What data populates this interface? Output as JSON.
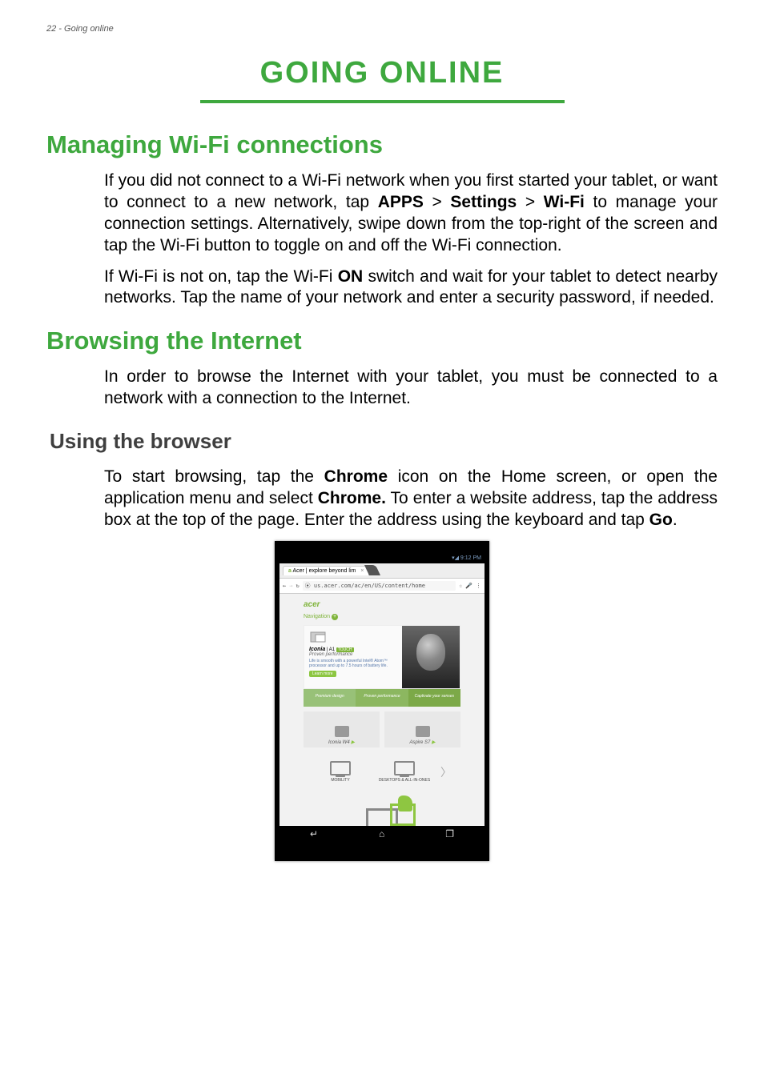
{
  "header": {
    "pageNumber": "22",
    "sectionName": "Going online"
  },
  "title": "GOING ONLINE",
  "sections": {
    "wifi": {
      "heading": "Managing Wi-Fi connections",
      "p1_a": "If you did not connect to a Wi-Fi network when you first started your tablet, or want to connect to a new network, tap ",
      "p1_apps": "APPS",
      "p1_gt1": " > ",
      "p1_settings": "Settings",
      "p1_gt2": " > ",
      "p1_wifi": "Wi-Fi",
      "p1_b": " to manage your connection settings. Alternatively, swipe down from the top-right of the screen and tap the Wi-Fi button to toggle on and off the Wi-Fi connection.",
      "p2_a": "If Wi-Fi is not on, tap the Wi-Fi ",
      "p2_on": "ON",
      "p2_b": " switch and wait for your tablet to detect nearby networks. Tap the name of your network and enter a security password, if needed."
    },
    "browse": {
      "heading": "Browsing the Internet",
      "p1": "In order to browse the Internet with your tablet, you must be connected to a network with a connection to the Internet.",
      "sub": "Using the browser",
      "p2_a": "To start browsing, tap the ",
      "p2_chrome1": "Chrome",
      "p2_b": " icon on the Home screen, or open the application menu and select ",
      "p2_chrome2": "Chrome.",
      "p2_c": " To enter a website address, tap the address box at the top of the page. Enter the address using the keyboard and tap ",
      "p2_go": "Go",
      "p2_d": "."
    }
  },
  "screenshot": {
    "statusTime": "9:12 PM",
    "tabTitle": "Acer | explore beyond lim",
    "addressUrl": "us.acer.com/ac/en/US/content/home",
    "starIcon": "star-outline-icon",
    "micIcon": "mic-icon",
    "menuIcon": "more-vert-icon",
    "acerLogo": "acer",
    "navLabel": "Navigation",
    "hero": {
      "title": "Iconia",
      "titleSuffix": " | A1",
      "badge": "TOUCH",
      "subtitle": "Proven performance",
      "blurb": "Life is smooth with a powerful\nIntel® Atom™ processor and\nup to 7.5 hours of battery life.",
      "learn": "Learn more"
    },
    "triTabs": [
      "Premium design",
      "Proven performance",
      "Captivate your senses"
    ],
    "products": [
      {
        "name": "Iconia W4"
      },
      {
        "name": "Aspire S7"
      }
    ],
    "categories": [
      {
        "name": "MOBILITY"
      },
      {
        "name": "DESKTOPS & ALL-IN-ONES"
      }
    ],
    "nav": {
      "back": "←⊐",
      "home": "⌂",
      "recent": "⧉"
    }
  }
}
